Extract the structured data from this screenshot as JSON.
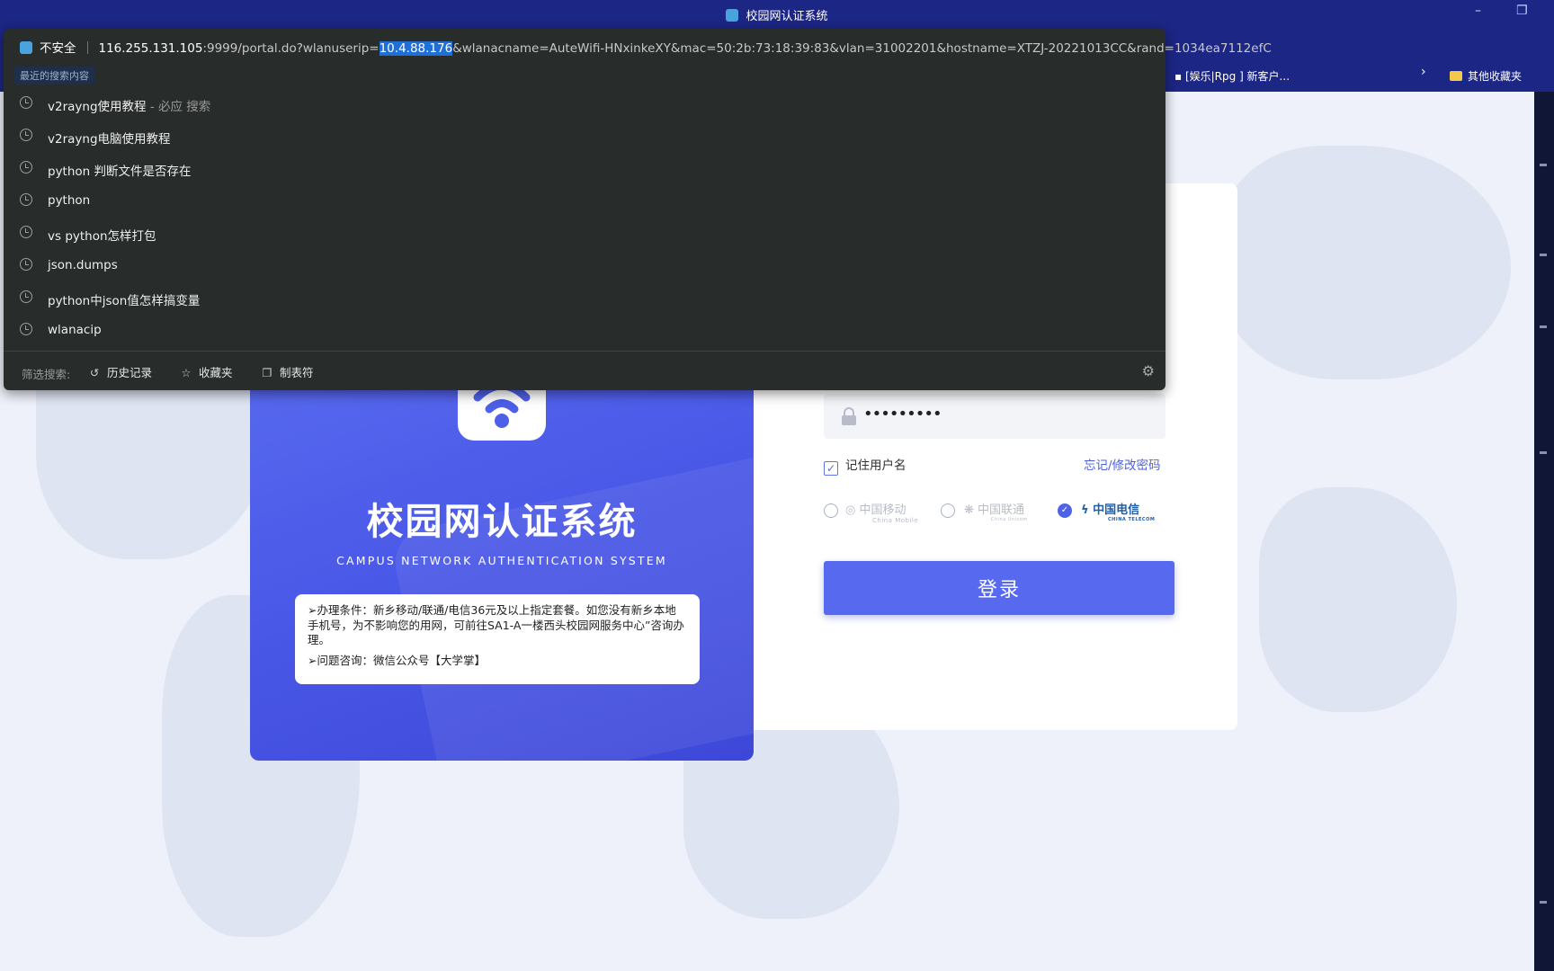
{
  "window": {
    "title": "校园网认证系统",
    "minimize": "–",
    "restore": "❐"
  },
  "bookmarks": {
    "entertainment": "[娱乐|Rpg ] 新客户...",
    "more": "›",
    "other_favorites": "其他收藏夹"
  },
  "toolbar_icons": [
    "extension-icon",
    "reading-glasses-icon",
    "puzzle-icon",
    "split-screen-icon",
    "favorites-icon",
    "collections-icon",
    "edge-icon",
    "profile-icon",
    "more-icon"
  ],
  "address_bar": {
    "security_label": "不安全",
    "url_host": "116.255.131.105",
    "url_before_sel": ":9999/portal.do?wlanuserip=",
    "url_selected": "10.4.88.176",
    "url_after_sel": "&wlanacname=AuteWifi-HNxinkeXY&mac=50:2b:73:18:39:83&vlan=31002201&hostname=XTZJ-20221013CC&rand=1034ea7112efC"
  },
  "dropdown": {
    "recent_label": "最近的搜索内容",
    "suggestions": [
      {
        "text": "v2rayng使用教程",
        "hint": " - 必应 搜索"
      },
      {
        "text": "v2rayng电脑使用教程",
        "hint": ""
      },
      {
        "text": "python 判断文件是否存在",
        "hint": ""
      },
      {
        "text": "python",
        "hint": ""
      },
      {
        "text": "vs python怎样打包",
        "hint": ""
      },
      {
        "text": "json.dumps",
        "hint": ""
      },
      {
        "text": "python中json值怎样搞变量",
        "hint": ""
      },
      {
        "text": "wlanacip",
        "hint": ""
      }
    ],
    "filter_label": "筛选搜索:",
    "filter_history": "历史记录",
    "filter_favorites": "收藏夹",
    "filter_tabs": "制表符"
  },
  "login": {
    "title": "校园网认证系统",
    "subtitle": "CAMPUS NETWORK AUTHENTICATION SYSTEM",
    "notice_1": "➢办理条件：新乡移动/联通/电信36元及以上指定套餐。如您没有新乡本地手机号，为不影响您的用网，可前往SA1-A一楼西头校园网服务中心”咨询办理。",
    "notice_2": "➢问题咨询：微信公众号【大学掌】",
    "password_masked": "•••••••••",
    "remember_label": "记住用户名",
    "forgot_label": "忘记/修改密码",
    "isp": {
      "mobile_cn": "中国移动",
      "mobile_en": "China Mobile",
      "unicom_cn": "中国联通",
      "unicom_en": "China Unicom",
      "telecom_cn": "中国电信",
      "telecom_en": "CHINA TELECOM",
      "selected": "telecom"
    },
    "button": "登录"
  },
  "colors": {
    "accent": "#5669ef",
    "chrome": "#1c2685",
    "dropdown_bg": "#282c2b"
  }
}
